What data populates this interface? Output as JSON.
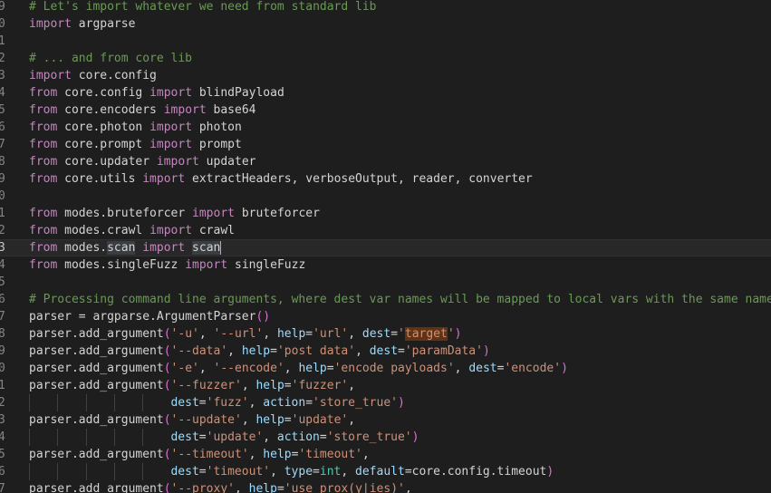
{
  "editor": {
    "theme_colors": {
      "background": "#1e1e1e",
      "keyword": "#c586c0",
      "string": "#ce9178",
      "comment": "#6a9955",
      "keyword_arg": "#9cdcfe",
      "builtin": "#4ec9b0"
    },
    "lines": [
      {
        "num": "9",
        "tokens": [
          {
            "t": "# Let's import whatever we need from standard lib",
            "c": "cm"
          }
        ]
      },
      {
        "num": "0",
        "tokens": [
          {
            "t": "import",
            "c": "kw"
          },
          {
            "t": " argparse",
            "c": "plain"
          }
        ]
      },
      {
        "num": "1",
        "tokens": []
      },
      {
        "num": "2",
        "tokens": [
          {
            "t": "# ... and from core lib",
            "c": "cm"
          }
        ]
      },
      {
        "num": "3",
        "tokens": [
          {
            "t": "import",
            "c": "kw"
          },
          {
            "t": " core.config",
            "c": "plain"
          }
        ]
      },
      {
        "num": "4",
        "tokens": [
          {
            "t": "from",
            "c": "kw"
          },
          {
            "t": " core.config ",
            "c": "plain"
          },
          {
            "t": "import",
            "c": "kw"
          },
          {
            "t": " blindPayload",
            "c": "plain"
          }
        ]
      },
      {
        "num": "5",
        "tokens": [
          {
            "t": "from",
            "c": "kw"
          },
          {
            "t": " core.encoders ",
            "c": "plain"
          },
          {
            "t": "import",
            "c": "kw"
          },
          {
            "t": " base64",
            "c": "plain"
          }
        ]
      },
      {
        "num": "6",
        "tokens": [
          {
            "t": "from",
            "c": "kw"
          },
          {
            "t": " core.photon ",
            "c": "plain"
          },
          {
            "t": "import",
            "c": "kw"
          },
          {
            "t": " photon",
            "c": "plain"
          }
        ]
      },
      {
        "num": "7",
        "tokens": [
          {
            "t": "from",
            "c": "kw"
          },
          {
            "t": " core.prompt ",
            "c": "plain"
          },
          {
            "t": "import",
            "c": "kw"
          },
          {
            "t": " prompt",
            "c": "plain"
          }
        ]
      },
      {
        "num": "8",
        "tokens": [
          {
            "t": "from",
            "c": "kw"
          },
          {
            "t": " core.updater ",
            "c": "plain"
          },
          {
            "t": "import",
            "c": "kw"
          },
          {
            "t": " updater",
            "c": "plain"
          }
        ]
      },
      {
        "num": "9",
        "tokens": [
          {
            "t": "from",
            "c": "kw"
          },
          {
            "t": " core.utils ",
            "c": "plain"
          },
          {
            "t": "import",
            "c": "kw"
          },
          {
            "t": " extractHeaders, verboseOutput, reader, converter",
            "c": "plain"
          }
        ]
      },
      {
        "num": "0",
        "tokens": []
      },
      {
        "num": "1",
        "tokens": [
          {
            "t": "from",
            "c": "kw"
          },
          {
            "t": " modes.bruteforcer ",
            "c": "plain"
          },
          {
            "t": "import",
            "c": "kw"
          },
          {
            "t": " bruteforcer",
            "c": "plain"
          }
        ]
      },
      {
        "num": "2",
        "tokens": [
          {
            "t": "from",
            "c": "kw"
          },
          {
            "t": " modes.crawl ",
            "c": "plain"
          },
          {
            "t": "import",
            "c": "kw"
          },
          {
            "t": " crawl",
            "c": "plain"
          }
        ]
      },
      {
        "num": "3",
        "current": true,
        "tokens": [
          {
            "t": "from",
            "c": "kw"
          },
          {
            "t": " modes.",
            "c": "plain"
          },
          {
            "t": "scan",
            "c": "plain",
            "hl": "sel"
          },
          {
            "t": " ",
            "c": "plain"
          },
          {
            "t": "import",
            "c": "kw"
          },
          {
            "t": " ",
            "c": "plain"
          },
          {
            "t": "scan",
            "c": "plain",
            "hl": "sel"
          },
          {
            "cursor": true
          }
        ]
      },
      {
        "num": "4",
        "tokens": [
          {
            "t": "from",
            "c": "kw"
          },
          {
            "t": " modes.singleFuzz ",
            "c": "plain"
          },
          {
            "t": "import",
            "c": "kw"
          },
          {
            "t": " singleFuzz",
            "c": "plain"
          }
        ]
      },
      {
        "num": "5",
        "tokens": []
      },
      {
        "num": "6",
        "tokens": [
          {
            "t": "# Processing command line arguments, where dest var names will be mapped to local vars with the same name",
            "c": "cm"
          }
        ]
      },
      {
        "num": "7",
        "tokens": [
          {
            "t": "parser = argparse.ArgumentParser",
            "c": "plain"
          },
          {
            "t": "()",
            "c": "par"
          }
        ]
      },
      {
        "num": "8",
        "tokens": [
          {
            "t": "parser.add_argument",
            "c": "plain"
          },
          {
            "t": "(",
            "c": "par"
          },
          {
            "t": "'-u'",
            "c": "str"
          },
          {
            "t": ", ",
            "c": "plain"
          },
          {
            "t": "'--url'",
            "c": "str"
          },
          {
            "t": ", ",
            "c": "plain"
          },
          {
            "t": "help",
            "c": "ykw"
          },
          {
            "t": "=",
            "c": "plain"
          },
          {
            "t": "'url'",
            "c": "str"
          },
          {
            "t": ", ",
            "c": "plain"
          },
          {
            "t": "dest",
            "c": "ykw"
          },
          {
            "t": "=",
            "c": "plain"
          },
          {
            "t": "'",
            "c": "str"
          },
          {
            "t": "target",
            "c": "str",
            "hl": "find"
          },
          {
            "t": "'",
            "c": "str"
          },
          {
            "t": ")",
            "c": "par"
          }
        ]
      },
      {
        "num": "9",
        "tokens": [
          {
            "t": "parser.add_argument",
            "c": "plain"
          },
          {
            "t": "(",
            "c": "par"
          },
          {
            "t": "'--data'",
            "c": "str"
          },
          {
            "t": ", ",
            "c": "plain"
          },
          {
            "t": "help",
            "c": "ykw"
          },
          {
            "t": "=",
            "c": "plain"
          },
          {
            "t": "'post data'",
            "c": "str"
          },
          {
            "t": ", ",
            "c": "plain"
          },
          {
            "t": "dest",
            "c": "ykw"
          },
          {
            "t": "=",
            "c": "plain"
          },
          {
            "t": "'paramData'",
            "c": "str"
          },
          {
            "t": ")",
            "c": "par"
          }
        ]
      },
      {
        "num": "0",
        "tokens": [
          {
            "t": "parser.add_argument",
            "c": "plain"
          },
          {
            "t": "(",
            "c": "par"
          },
          {
            "t": "'-e'",
            "c": "str"
          },
          {
            "t": ", ",
            "c": "plain"
          },
          {
            "t": "'--encode'",
            "c": "str"
          },
          {
            "t": ", ",
            "c": "plain"
          },
          {
            "t": "help",
            "c": "ykw"
          },
          {
            "t": "=",
            "c": "plain"
          },
          {
            "t": "'encode payloads'",
            "c": "str"
          },
          {
            "t": ", ",
            "c": "plain"
          },
          {
            "t": "dest",
            "c": "ykw"
          },
          {
            "t": "=",
            "c": "plain"
          },
          {
            "t": "'encode'",
            "c": "str"
          },
          {
            "t": ")",
            "c": "par"
          }
        ]
      },
      {
        "num": "1",
        "tokens": [
          {
            "t": "parser.add_argument",
            "c": "plain"
          },
          {
            "t": "(",
            "c": "par"
          },
          {
            "t": "'--fuzzer'",
            "c": "str"
          },
          {
            "t": ", ",
            "c": "plain"
          },
          {
            "t": "help",
            "c": "ykw"
          },
          {
            "t": "=",
            "c": "plain"
          },
          {
            "t": "'fuzzer'",
            "c": "str"
          },
          {
            "t": ",",
            "c": "plain"
          }
        ]
      },
      {
        "num": "2",
        "indent": 5,
        "tokens": [
          {
            "t": "dest",
            "c": "ykw"
          },
          {
            "t": "=",
            "c": "plain"
          },
          {
            "t": "'fuzz'",
            "c": "str"
          },
          {
            "t": ", ",
            "c": "plain"
          },
          {
            "t": "action",
            "c": "ykw"
          },
          {
            "t": "=",
            "c": "plain"
          },
          {
            "t": "'store_true'",
            "c": "str"
          },
          {
            "t": ")",
            "c": "par"
          }
        ]
      },
      {
        "num": "3",
        "tokens": [
          {
            "t": "parser.add_argument",
            "c": "plain"
          },
          {
            "t": "(",
            "c": "par"
          },
          {
            "t": "'--update'",
            "c": "str"
          },
          {
            "t": ", ",
            "c": "plain"
          },
          {
            "t": "help",
            "c": "ykw"
          },
          {
            "t": "=",
            "c": "plain"
          },
          {
            "t": "'update'",
            "c": "str"
          },
          {
            "t": ",",
            "c": "plain"
          }
        ]
      },
      {
        "num": "4",
        "indent": 5,
        "tokens": [
          {
            "t": "dest",
            "c": "ykw"
          },
          {
            "t": "=",
            "c": "plain"
          },
          {
            "t": "'update'",
            "c": "str"
          },
          {
            "t": ", ",
            "c": "plain"
          },
          {
            "t": "action",
            "c": "ykw"
          },
          {
            "t": "=",
            "c": "plain"
          },
          {
            "t": "'store_true'",
            "c": "str"
          },
          {
            "t": ")",
            "c": "par"
          }
        ]
      },
      {
        "num": "5",
        "tokens": [
          {
            "t": "parser.add_argument",
            "c": "plain"
          },
          {
            "t": "(",
            "c": "par"
          },
          {
            "t": "'--timeout'",
            "c": "str"
          },
          {
            "t": ", ",
            "c": "plain"
          },
          {
            "t": "help",
            "c": "ykw"
          },
          {
            "t": "=",
            "c": "plain"
          },
          {
            "t": "'timeout'",
            "c": "str"
          },
          {
            "t": ",",
            "c": "plain"
          }
        ]
      },
      {
        "num": "6",
        "indent": 5,
        "tokens": [
          {
            "t": "dest",
            "c": "ykw"
          },
          {
            "t": "=",
            "c": "plain"
          },
          {
            "t": "'timeout'",
            "c": "str"
          },
          {
            "t": ", ",
            "c": "plain"
          },
          {
            "t": "type",
            "c": "ykw"
          },
          {
            "t": "=",
            "c": "plain"
          },
          {
            "t": "int",
            "c": "bi"
          },
          {
            "t": ", ",
            "c": "plain"
          },
          {
            "t": "default",
            "c": "ykw"
          },
          {
            "t": "=",
            "c": "plain"
          },
          {
            "t": "core.config.timeout",
            "c": "plain"
          },
          {
            "t": ")",
            "c": "par"
          }
        ]
      },
      {
        "num": "7",
        "tokens": [
          {
            "t": "parser.add_argument",
            "c": "plain"
          },
          {
            "t": "(",
            "c": "par"
          },
          {
            "t": "'--proxy'",
            "c": "str"
          },
          {
            "t": ", ",
            "c": "plain"
          },
          {
            "t": "help",
            "c": "ykw"
          },
          {
            "t": "=",
            "c": "plain"
          },
          {
            "t": "'use prox(y|ies)'",
            "c": "str"
          },
          {
            "t": ",",
            "c": "plain"
          }
        ]
      }
    ]
  }
}
